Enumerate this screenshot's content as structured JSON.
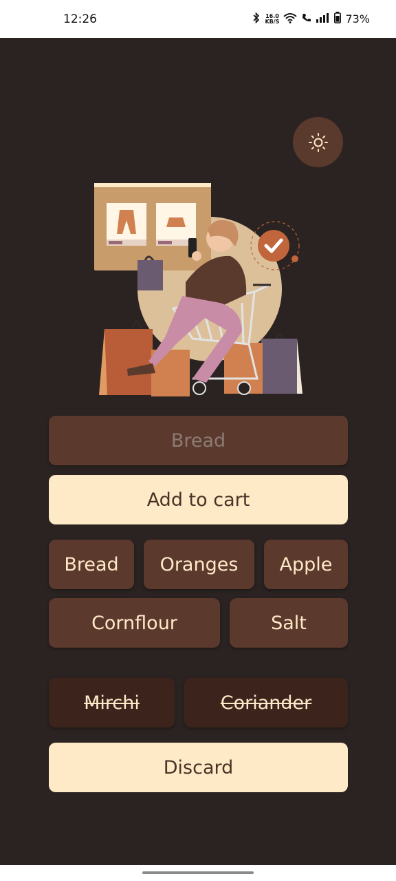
{
  "status_bar": {
    "time": "12:26",
    "net_speed_value": "16.0",
    "net_speed_unit": "KB/S",
    "battery": "73%"
  },
  "theme_toggle": {
    "icon": "sun-icon"
  },
  "input": {
    "placeholder": "Bread"
  },
  "add_button": {
    "label": "Add to cart"
  },
  "items": [
    {
      "label": "Bread"
    },
    {
      "label": "Oranges"
    },
    {
      "label": "Apple"
    },
    {
      "label": "Cornflour"
    },
    {
      "label": "Salt"
    }
  ],
  "done_items": [
    {
      "label": "Mirchi"
    },
    {
      "label": "Coriander"
    }
  ],
  "discard_button": {
    "label": "Discard"
  },
  "colors": {
    "background": "#2b2322",
    "chip": "#5b3a2d",
    "chip_done": "#3c241d",
    "accent_button": "#ffeac7",
    "button_text": "#4a3227"
  }
}
